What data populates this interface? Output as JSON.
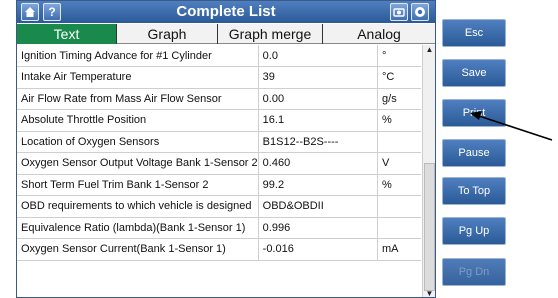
{
  "header": {
    "title": "Complete List",
    "home_icon": "home-icon",
    "help_label": "?",
    "camera_icon": "camera-icon",
    "record_icon": "record-icon"
  },
  "tabs": [
    {
      "label": "Text",
      "active": true
    },
    {
      "label": "Graph",
      "active": false
    },
    {
      "label": "Graph merge",
      "active": false
    },
    {
      "label": "Analog",
      "active": false
    }
  ],
  "rows": [
    {
      "name": "Ignition Timing Advance for #1 Cylinder",
      "value": "0.0",
      "unit": "°"
    },
    {
      "name": "Intake Air Temperature",
      "value": "39",
      "unit": "°C"
    },
    {
      "name": "Air Flow Rate from Mass Air Flow Sensor",
      "value": "0.00",
      "unit": "g/s"
    },
    {
      "name": "Absolute Throttle Position",
      "value": "16.1",
      "unit": "%"
    },
    {
      "name": "Location of Oxygen Sensors",
      "value": "B1S12--B2S----",
      "unit": ""
    },
    {
      "name": "Oxygen Sensor Output Voltage Bank 1-Sensor 2",
      "value": "0.460",
      "unit": "V"
    },
    {
      "name": "Short Term Fuel Trim Bank 1-Sensor 2",
      "value": "99.2",
      "unit": "%"
    },
    {
      "name": "OBD requirements to which vehicle is designed",
      "value": "OBD&OBDII",
      "unit": ""
    },
    {
      "name": "Equivalence Ratio (lambda)(Bank 1-Sensor 1)",
      "value": "0.996",
      "unit": ""
    },
    {
      "name": "Oxygen Sensor Current(Bank 1-Sensor 1)",
      "value": "-0.016",
      "unit": "mA"
    }
  ],
  "sidebar": {
    "esc": "Esc",
    "save": "Save",
    "print": "Print",
    "pause": "Pause",
    "to_top": "To Top",
    "pg_up": "Pg Up",
    "pg_dn": "Pg Dn"
  },
  "colors": {
    "title_bar": "#2b5a97",
    "active_tab": "#1a8a4c",
    "button": "#3a6aa8"
  }
}
